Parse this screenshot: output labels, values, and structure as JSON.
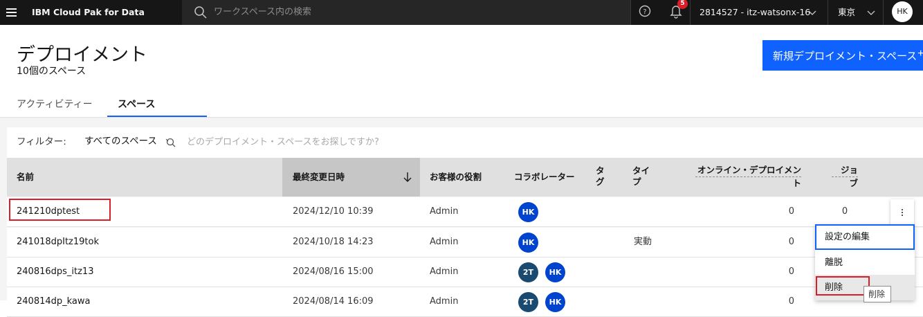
{
  "header": {
    "brand": "IBM Cloud Pak for Data",
    "search_placeholder": "ワークスペース内の検索",
    "notification_count": "5",
    "account": "2814527 - itz-watsonx-16",
    "region": "東京",
    "user_initials": "HK"
  },
  "page": {
    "title": "デプロイメント",
    "subtitle": "10個のスペース",
    "new_space_button": "新規デプロイメント・スペース",
    "new_space_plus": "+"
  },
  "tabs": [
    {
      "label": "アクティビティー",
      "selected": false
    },
    {
      "label": "スペース",
      "selected": true
    }
  ],
  "filter": {
    "label": "フィルター:",
    "value": "すべてのスペース",
    "search_placeholder": "どのデプロイメント・スペースをお探しですか?"
  },
  "table": {
    "columns": {
      "name": "名前",
      "modified": "最終変更日時",
      "role": "お客様の役割",
      "collaborators": "コラボレーター",
      "tags_line1": "タ",
      "tags_line2": "グ",
      "type_line1": "タイ",
      "type_line2": "プ",
      "online_line1": "オンライン・デプロイメン",
      "online_line2": "ト",
      "jobs_line1": "ジョ",
      "jobs_line2": "ブ"
    },
    "rows": [
      {
        "name": "241210dptest",
        "modified": "2024/12/10 10:39",
        "role": "Admin",
        "collaborators": [
          "HK"
        ],
        "type": "",
        "online": "0",
        "jobs": "0"
      },
      {
        "name": "241018dpItz19tok",
        "modified": "2024/10/18 14:23",
        "role": "Admin",
        "collaborators": [
          "HK"
        ],
        "type": "実動",
        "online": "0",
        "jobs": ""
      },
      {
        "name": "240816dps_itz13",
        "modified": "2024/08/16 15:00",
        "role": "Admin",
        "collaborators": [
          "2T",
          "HK"
        ],
        "type": "",
        "online": "0",
        "jobs": ""
      },
      {
        "name": "240814dp_kawa",
        "modified": "2024/08/14 16:09",
        "role": "Admin",
        "collaborators": [
          "2T",
          "HK"
        ],
        "type": "",
        "online": "0",
        "jobs": ""
      }
    ]
  },
  "overflow_menu": {
    "items": [
      "設定の編集",
      "離脱",
      "削除"
    ],
    "tooltip": "削除"
  },
  "colors": {
    "header_bg": "#161616",
    "primary": "#0f62fe",
    "highlight": "#da1e28",
    "avatar_hk": "#0043ce",
    "avatar_2t": "#1a4a70"
  }
}
